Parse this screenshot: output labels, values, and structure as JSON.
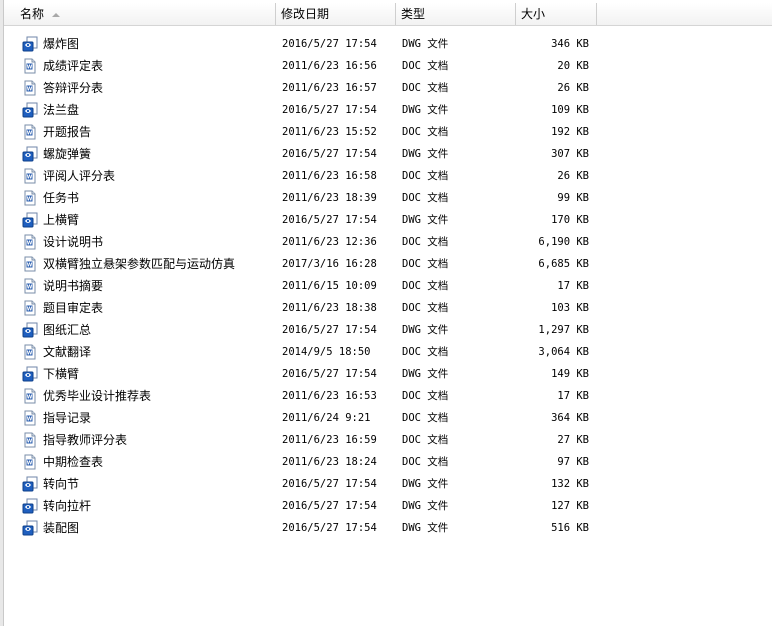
{
  "columns": {
    "name": "名称",
    "date": "修改日期",
    "type": "类型",
    "size": "大小"
  },
  "files": [
    {
      "name": "爆炸图",
      "date": "2016/5/27 17:54",
      "type": "DWG 文件",
      "size": "346 KB",
      "icon": "dwg-file-icon"
    },
    {
      "name": "成绩评定表",
      "date": "2011/6/23 16:56",
      "type": "DOC 文档",
      "size": "20 KB",
      "icon": "doc-file-icon"
    },
    {
      "name": "答辩评分表",
      "date": "2011/6/23 16:57",
      "type": "DOC 文档",
      "size": "26 KB",
      "icon": "doc-file-icon"
    },
    {
      "name": "法兰盘",
      "date": "2016/5/27 17:54",
      "type": "DWG 文件",
      "size": "109 KB",
      "icon": "dwg-file-icon"
    },
    {
      "name": "开题报告",
      "date": "2011/6/23 15:52",
      "type": "DOC 文档",
      "size": "192 KB",
      "icon": "doc-file-icon"
    },
    {
      "name": "螺旋弹簧",
      "date": "2016/5/27 17:54",
      "type": "DWG 文件",
      "size": "307 KB",
      "icon": "dwg-file-icon"
    },
    {
      "name": "评阅人评分表",
      "date": "2011/6/23 16:58",
      "type": "DOC 文档",
      "size": "26 KB",
      "icon": "doc-file-icon"
    },
    {
      "name": "任务书",
      "date": "2011/6/23 18:39",
      "type": "DOC 文档",
      "size": "99 KB",
      "icon": "doc-file-icon"
    },
    {
      "name": "上横臂",
      "date": "2016/5/27 17:54",
      "type": "DWG 文件",
      "size": "170 KB",
      "icon": "dwg-file-icon"
    },
    {
      "name": "设计说明书",
      "date": "2011/6/23 12:36",
      "type": "DOC 文档",
      "size": "6,190 KB",
      "icon": "doc-file-icon"
    },
    {
      "name": "双横臂独立悬架参数匹配与运动仿真",
      "date": "2017/3/16 16:28",
      "type": "DOC 文档",
      "size": "6,685 KB",
      "icon": "doc-file-icon"
    },
    {
      "name": "说明书摘要",
      "date": "2011/6/15 10:09",
      "type": "DOC 文档",
      "size": "17 KB",
      "icon": "doc-file-icon"
    },
    {
      "name": "题目审定表",
      "date": "2011/6/23 18:38",
      "type": "DOC 文档",
      "size": "103 KB",
      "icon": "doc-file-icon"
    },
    {
      "name": "图纸汇总",
      "date": "2016/5/27 17:54",
      "type": "DWG 文件",
      "size": "1,297 KB",
      "icon": "dwg-file-icon"
    },
    {
      "name": "文献翻译",
      "date": "2014/9/5 18:50",
      "type": "DOC 文档",
      "size": "3,064 KB",
      "icon": "doc-file-icon"
    },
    {
      "name": "下横臂",
      "date": "2016/5/27 17:54",
      "type": "DWG 文件",
      "size": "149 KB",
      "icon": "dwg-file-icon"
    },
    {
      "name": "优秀毕业设计推荐表",
      "date": "2011/6/23 16:53",
      "type": "DOC 文档",
      "size": "17 KB",
      "icon": "doc-file-icon"
    },
    {
      "name": "指导记录",
      "date": "2011/6/24 9:21",
      "type": "DOC 文档",
      "size": "364 KB",
      "icon": "doc-file-icon"
    },
    {
      "name": "指导教师评分表",
      "date": "2011/6/23 16:59",
      "type": "DOC 文档",
      "size": "27 KB",
      "icon": "doc-file-icon"
    },
    {
      "name": "中期检查表",
      "date": "2011/6/23 18:24",
      "type": "DOC 文档",
      "size": "97 KB",
      "icon": "doc-file-icon"
    },
    {
      "name": "转向节",
      "date": "2016/5/27 17:54",
      "type": "DWG 文件",
      "size": "132 KB",
      "icon": "dwg-file-icon"
    },
    {
      "name": "转向拉杆",
      "date": "2016/5/27 17:54",
      "type": "DWG 文件",
      "size": "127 KB",
      "icon": "dwg-file-icon"
    },
    {
      "name": "装配图",
      "date": "2016/5/27 17:54",
      "type": "DWG 文件",
      "size": "516 KB",
      "icon": "dwg-file-icon"
    }
  ]
}
